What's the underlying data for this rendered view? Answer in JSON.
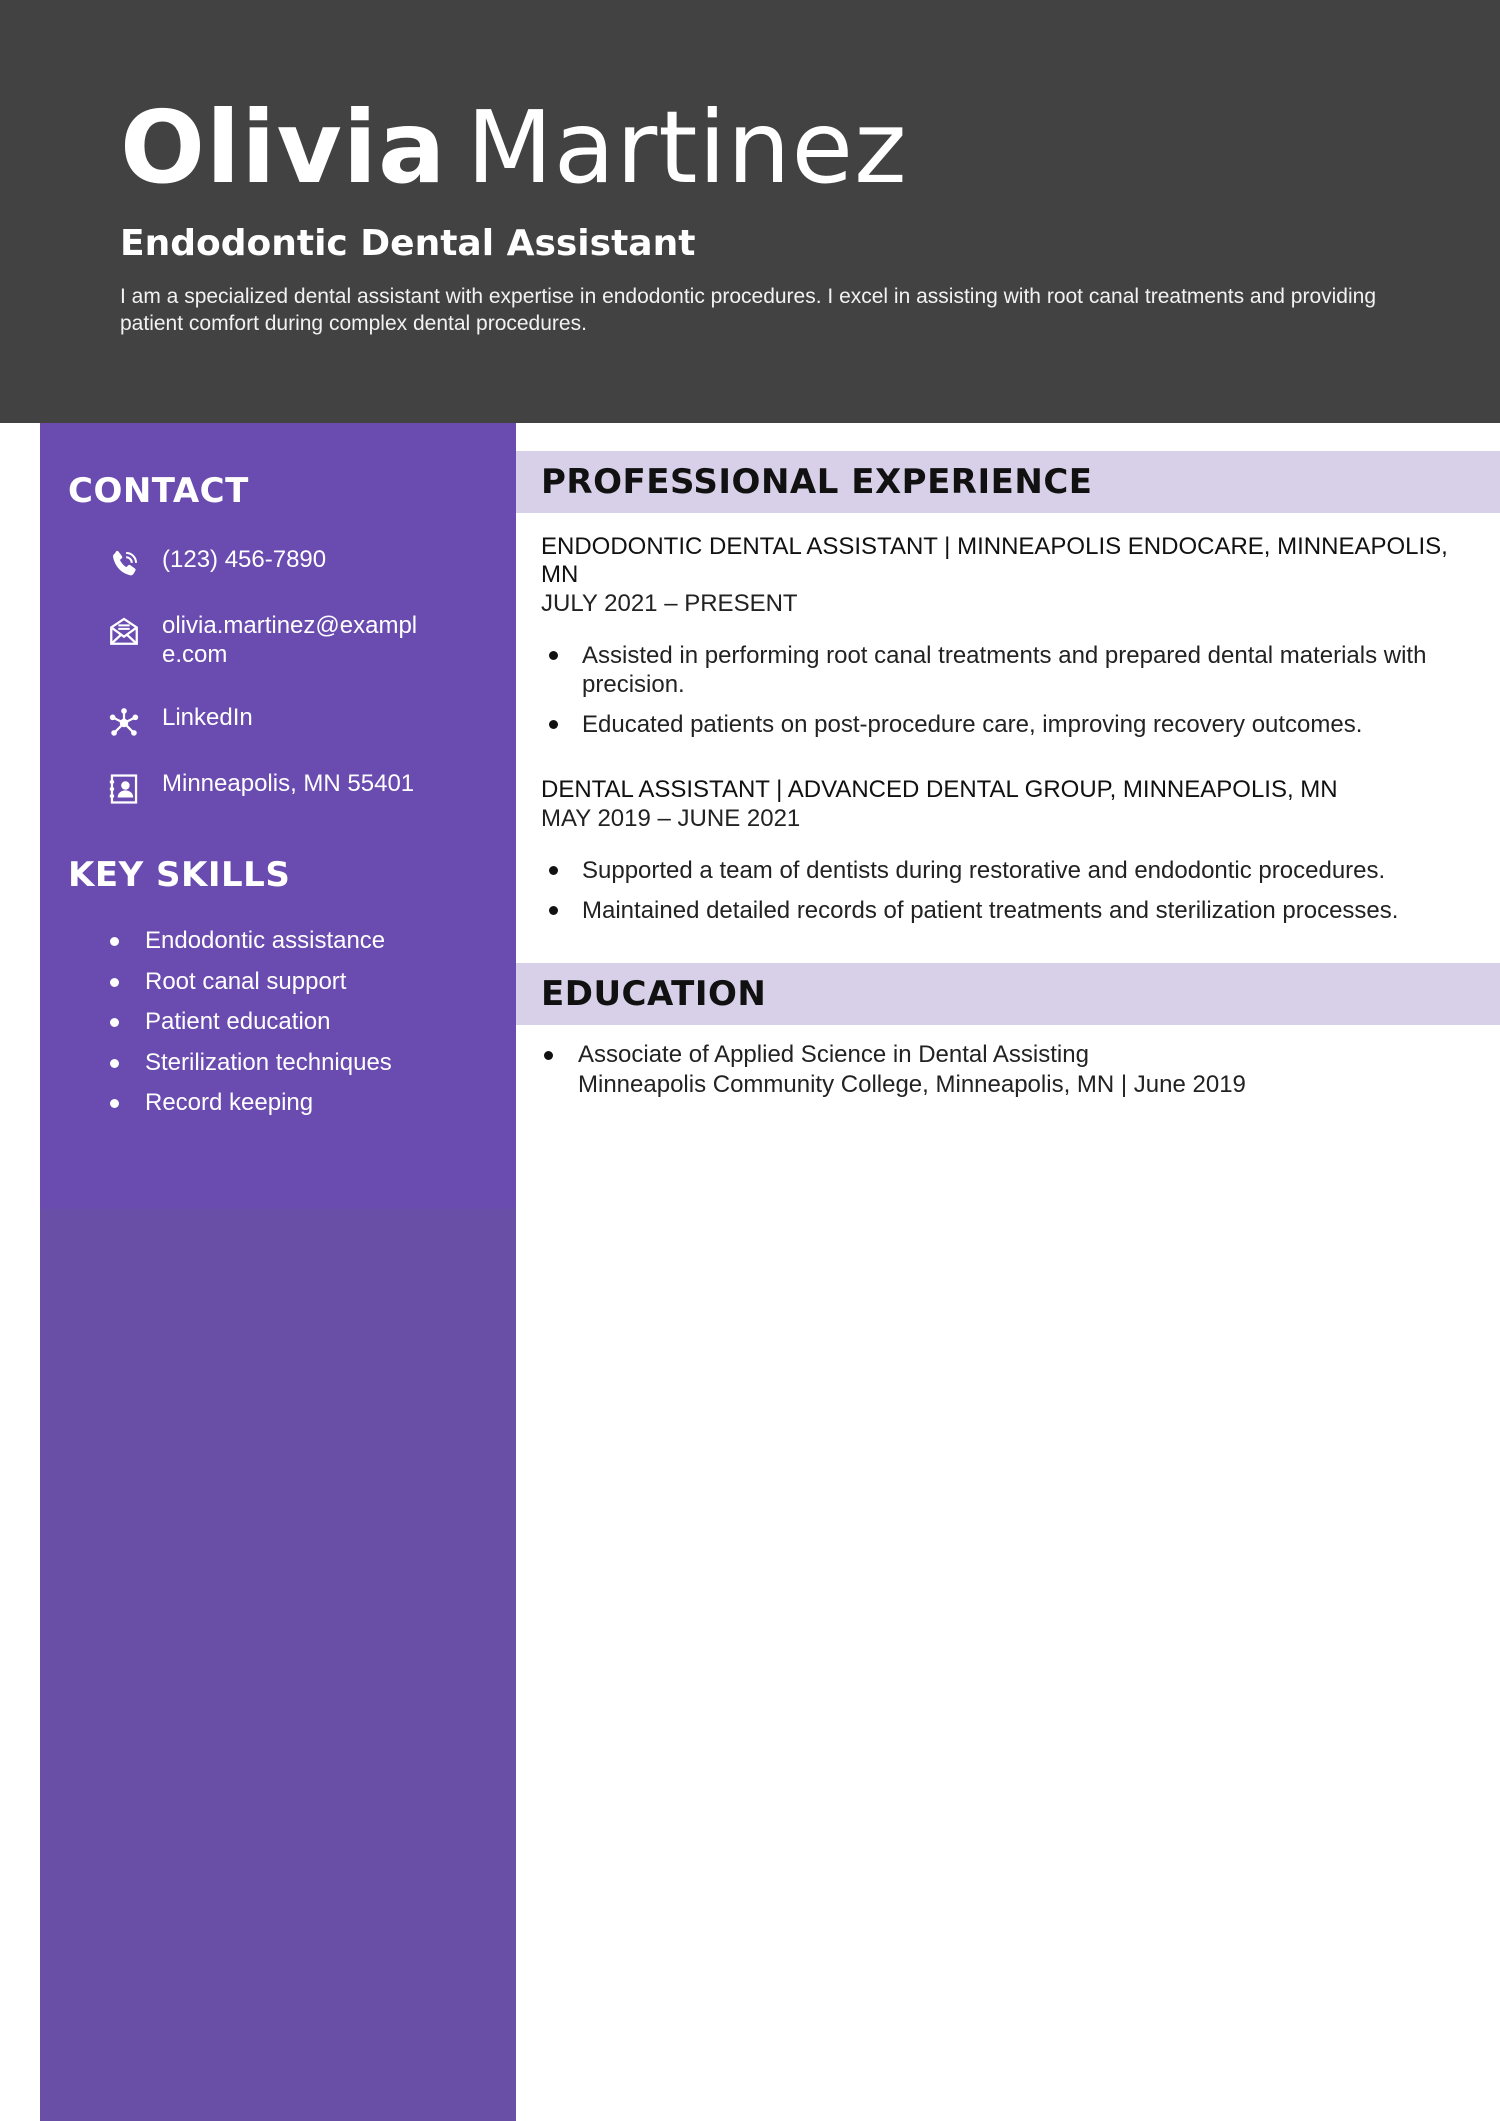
{
  "header": {
    "first_name": "Olivia",
    "last_name": "Martinez",
    "job_title": "Endodontic Dental Assistant",
    "summary": "I am a specialized dental assistant with expertise in endodontic procedures. I excel in assisting with root canal treatments and providing patient comfort during complex dental procedures."
  },
  "sidebar": {
    "contact_heading": "CONTACT",
    "contact": [
      {
        "icon": "phone-icon",
        "text": "(123) 456-7890"
      },
      {
        "icon": "envelope-icon",
        "text": "olivia.martinez@example.com"
      },
      {
        "icon": "network-icon",
        "text": "LinkedIn"
      },
      {
        "icon": "address-card-icon",
        "text": "Minneapolis, MN 55401"
      }
    ],
    "skills_heading": "KEY SKILLS",
    "skills": [
      "Endodontic assistance",
      "Root canal support",
      "Patient education",
      "Sterilization techniques",
      "Record keeping"
    ]
  },
  "experience": {
    "heading": "PROFESSIONAL EXPERIENCE",
    "jobs": [
      {
        "title_line": "ENDODONTIC DENTAL ASSISTANT | MINNEAPOLIS ENDOCARE, MINNEAPOLIS, MN",
        "dates": "JULY 2021 – PRESENT",
        "bullets": [
          "Assisted in performing root canal treatments and prepared dental materials with precision.",
          "Educated patients on post-procedure care, improving recovery outcomes."
        ]
      },
      {
        "title_line": "DENTAL ASSISTANT | ADVANCED DENTAL GROUP, MINNEAPOLIS, MN",
        "dates": "MAY 2019 – JUNE 2021",
        "bullets": [
          "Supported a team of dentists during restorative and endodontic procedures.",
          "Maintained detailed records of patient treatments and sterilization processes."
        ]
      }
    ]
  },
  "education": {
    "heading": "EDUCATION",
    "degree": "Associate of Applied Science in Dental Assisting",
    "school_line": "Minneapolis Community College, Minneapolis, MN | June 2019"
  },
  "colors": {
    "header_bg": "#424242",
    "sidebar_bg": "#6a4bb0",
    "section_bar_bg": "#d8d0e8"
  }
}
